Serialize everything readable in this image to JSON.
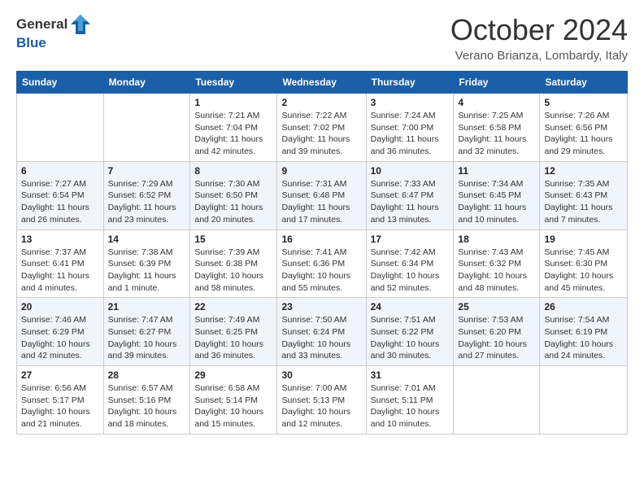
{
  "header": {
    "logo_general": "General",
    "logo_blue": "Blue",
    "month_title": "October 2024",
    "subtitle": "Verano Brianza, Lombardy, Italy"
  },
  "weekdays": [
    "Sunday",
    "Monday",
    "Tuesday",
    "Wednesday",
    "Thursday",
    "Friday",
    "Saturday"
  ],
  "rows": [
    [
      {
        "day": "",
        "info": ""
      },
      {
        "day": "",
        "info": ""
      },
      {
        "day": "1",
        "info": "Sunrise: 7:21 AM\nSunset: 7:04 PM\nDaylight: 11 hours and 42 minutes."
      },
      {
        "day": "2",
        "info": "Sunrise: 7:22 AM\nSunset: 7:02 PM\nDaylight: 11 hours and 39 minutes."
      },
      {
        "day": "3",
        "info": "Sunrise: 7:24 AM\nSunset: 7:00 PM\nDaylight: 11 hours and 36 minutes."
      },
      {
        "day": "4",
        "info": "Sunrise: 7:25 AM\nSunset: 6:58 PM\nDaylight: 11 hours and 32 minutes."
      },
      {
        "day": "5",
        "info": "Sunrise: 7:26 AM\nSunset: 6:56 PM\nDaylight: 11 hours and 29 minutes."
      }
    ],
    [
      {
        "day": "6",
        "info": "Sunrise: 7:27 AM\nSunset: 6:54 PM\nDaylight: 11 hours and 26 minutes."
      },
      {
        "day": "7",
        "info": "Sunrise: 7:29 AM\nSunset: 6:52 PM\nDaylight: 11 hours and 23 minutes."
      },
      {
        "day": "8",
        "info": "Sunrise: 7:30 AM\nSunset: 6:50 PM\nDaylight: 11 hours and 20 minutes."
      },
      {
        "day": "9",
        "info": "Sunrise: 7:31 AM\nSunset: 6:48 PM\nDaylight: 11 hours and 17 minutes."
      },
      {
        "day": "10",
        "info": "Sunrise: 7:33 AM\nSunset: 6:47 PM\nDaylight: 11 hours and 13 minutes."
      },
      {
        "day": "11",
        "info": "Sunrise: 7:34 AM\nSunset: 6:45 PM\nDaylight: 11 hours and 10 minutes."
      },
      {
        "day": "12",
        "info": "Sunrise: 7:35 AM\nSunset: 6:43 PM\nDaylight: 11 hours and 7 minutes."
      }
    ],
    [
      {
        "day": "13",
        "info": "Sunrise: 7:37 AM\nSunset: 6:41 PM\nDaylight: 11 hours and 4 minutes."
      },
      {
        "day": "14",
        "info": "Sunrise: 7:38 AM\nSunset: 6:39 PM\nDaylight: 11 hours and 1 minute."
      },
      {
        "day": "15",
        "info": "Sunrise: 7:39 AM\nSunset: 6:38 PM\nDaylight: 10 hours and 58 minutes."
      },
      {
        "day": "16",
        "info": "Sunrise: 7:41 AM\nSunset: 6:36 PM\nDaylight: 10 hours and 55 minutes."
      },
      {
        "day": "17",
        "info": "Sunrise: 7:42 AM\nSunset: 6:34 PM\nDaylight: 10 hours and 52 minutes."
      },
      {
        "day": "18",
        "info": "Sunrise: 7:43 AM\nSunset: 6:32 PM\nDaylight: 10 hours and 48 minutes."
      },
      {
        "day": "19",
        "info": "Sunrise: 7:45 AM\nSunset: 6:30 PM\nDaylight: 10 hours and 45 minutes."
      }
    ],
    [
      {
        "day": "20",
        "info": "Sunrise: 7:46 AM\nSunset: 6:29 PM\nDaylight: 10 hours and 42 minutes."
      },
      {
        "day": "21",
        "info": "Sunrise: 7:47 AM\nSunset: 6:27 PM\nDaylight: 10 hours and 39 minutes."
      },
      {
        "day": "22",
        "info": "Sunrise: 7:49 AM\nSunset: 6:25 PM\nDaylight: 10 hours and 36 minutes."
      },
      {
        "day": "23",
        "info": "Sunrise: 7:50 AM\nSunset: 6:24 PM\nDaylight: 10 hours and 33 minutes."
      },
      {
        "day": "24",
        "info": "Sunrise: 7:51 AM\nSunset: 6:22 PM\nDaylight: 10 hours and 30 minutes."
      },
      {
        "day": "25",
        "info": "Sunrise: 7:53 AM\nSunset: 6:20 PM\nDaylight: 10 hours and 27 minutes."
      },
      {
        "day": "26",
        "info": "Sunrise: 7:54 AM\nSunset: 6:19 PM\nDaylight: 10 hours and 24 minutes."
      }
    ],
    [
      {
        "day": "27",
        "info": "Sunrise: 6:56 AM\nSunset: 5:17 PM\nDaylight: 10 hours and 21 minutes."
      },
      {
        "day": "28",
        "info": "Sunrise: 6:57 AM\nSunset: 5:16 PM\nDaylight: 10 hours and 18 minutes."
      },
      {
        "day": "29",
        "info": "Sunrise: 6:58 AM\nSunset: 5:14 PM\nDaylight: 10 hours and 15 minutes."
      },
      {
        "day": "30",
        "info": "Sunrise: 7:00 AM\nSunset: 5:13 PM\nDaylight: 10 hours and 12 minutes."
      },
      {
        "day": "31",
        "info": "Sunrise: 7:01 AM\nSunset: 5:11 PM\nDaylight: 10 hours and 10 minutes."
      },
      {
        "day": "",
        "info": ""
      },
      {
        "day": "",
        "info": ""
      }
    ]
  ]
}
